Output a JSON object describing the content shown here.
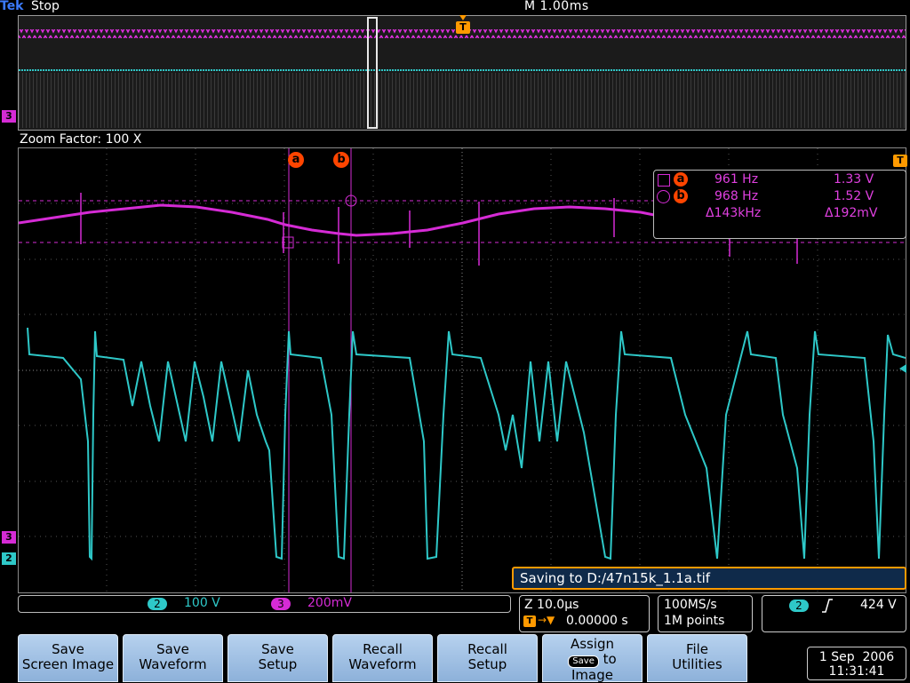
{
  "status": {
    "brand": "Tek",
    "acq_state": "Stop",
    "timebase": "M 1.00ms"
  },
  "zoom": {
    "label": "Zoom Factor: 100 X"
  },
  "markers": {
    "trigger": "T",
    "ch3": "3",
    "ch2": "2"
  },
  "cursors": {
    "a_label": "a",
    "b_label": "b",
    "readout": {
      "a": {
        "label": "a",
        "freq": "961 Hz",
        "volt": "1.33 V"
      },
      "b": {
        "label": "b",
        "freq": "968 Hz",
        "volt": "1.52 V"
      },
      "delta": {
        "freq": "Δ143kHz",
        "volt": "Δ192mV"
      }
    }
  },
  "saving": {
    "text": "Saving to D:/47n15k_1.1a.tif"
  },
  "channels": [
    {
      "num": "2",
      "scale": "100 V",
      "color": "#2ec8c8"
    },
    {
      "num": "3",
      "scale": "200mV",
      "color": "#d52bd5"
    }
  ],
  "horizontal": {
    "zoom_scale": "Z 10.0µs",
    "position": "0.00000 s"
  },
  "acquisition": {
    "rate": "100MS/s",
    "points": "1M points"
  },
  "trigger": {
    "channel": "2",
    "slope": "rising-edge-icon",
    "level": "424 V"
  },
  "softkeys": [
    {
      "line1": "Save",
      "line2": "Screen Image"
    },
    {
      "line1": "Save",
      "line2": "Waveform"
    },
    {
      "line1": "Save",
      "line2": "Setup"
    },
    {
      "line1": "Recall",
      "line2": "Waveform"
    },
    {
      "line1": "Recall",
      "line2": "Setup"
    },
    {
      "line1": "Assign",
      "badge": "Save",
      "line2": "to",
      "line3": "Image"
    },
    {
      "line1": "File",
      "line2": "Utilities"
    }
  ],
  "datetime": {
    "date": "1 Sep  2006",
    "time": "11:31:41"
  }
}
